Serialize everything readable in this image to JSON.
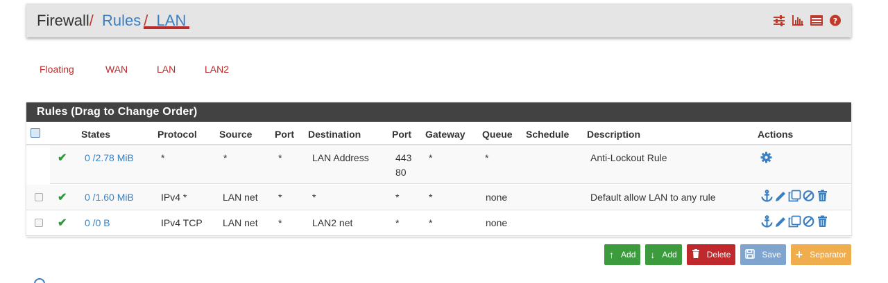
{
  "breadcrumb": {
    "root": "Firewall",
    "sep": "/",
    "level1": "Rules",
    "level2": "LAN"
  },
  "header_icons": [
    "sliders-icon",
    "bar-chart-icon",
    "list-table-icon",
    "help-icon"
  ],
  "tabs": [
    {
      "label": "Floating",
      "active": false
    },
    {
      "label": "WAN",
      "active": false
    },
    {
      "label": "LAN",
      "active": true
    },
    {
      "label": "LAN2",
      "active": false
    }
  ],
  "panel": {
    "title": "Rules (Drag to Change Order)"
  },
  "columns": {
    "states": "States",
    "protocol": "Protocol",
    "source": "Source",
    "port": "Port",
    "destination": "Destination",
    "dport": "Port",
    "gateway": "Gateway",
    "queue": "Queue",
    "schedule": "Schedule",
    "description": "Description",
    "actions": "Actions"
  },
  "rows": [
    {
      "check": "✔",
      "states": "0 /2.78 MiB",
      "protocol": "*",
      "source": "*",
      "port": "*",
      "destination": "LAN Address",
      "dport_line1": "443",
      "dport_line2": "80",
      "gateway": "*",
      "queue": "*",
      "schedule": "",
      "description": "Anti-Lockout Rule"
    },
    {
      "check": "✔",
      "states": "0 /1.60 MiB",
      "protocol": "IPv4 *",
      "source": "LAN net",
      "port": "*",
      "destination": "*",
      "dport": "*",
      "gateway": "*",
      "queue": "none",
      "schedule": "",
      "description": "Default allow LAN to any rule"
    },
    {
      "check": "✔",
      "states": "0 /0 B",
      "protocol": "IPv4 TCP",
      "source": "LAN net",
      "port": "*",
      "destination": "LAN2 net",
      "dport": "*",
      "gateway": "*",
      "queue": "none",
      "schedule": "",
      "description": ""
    }
  ],
  "buttons": {
    "add_top": "Add",
    "add_bottom": "Add",
    "delete": "Delete",
    "save": "Save",
    "separator": "Separator"
  },
  "colors": {
    "accent_red": "#b82c2c",
    "link_blue": "#3a7fc1",
    "success_green": "#3c9b3c",
    "panel_dark": "#424242",
    "warning_orange": "#f0ad4e"
  }
}
